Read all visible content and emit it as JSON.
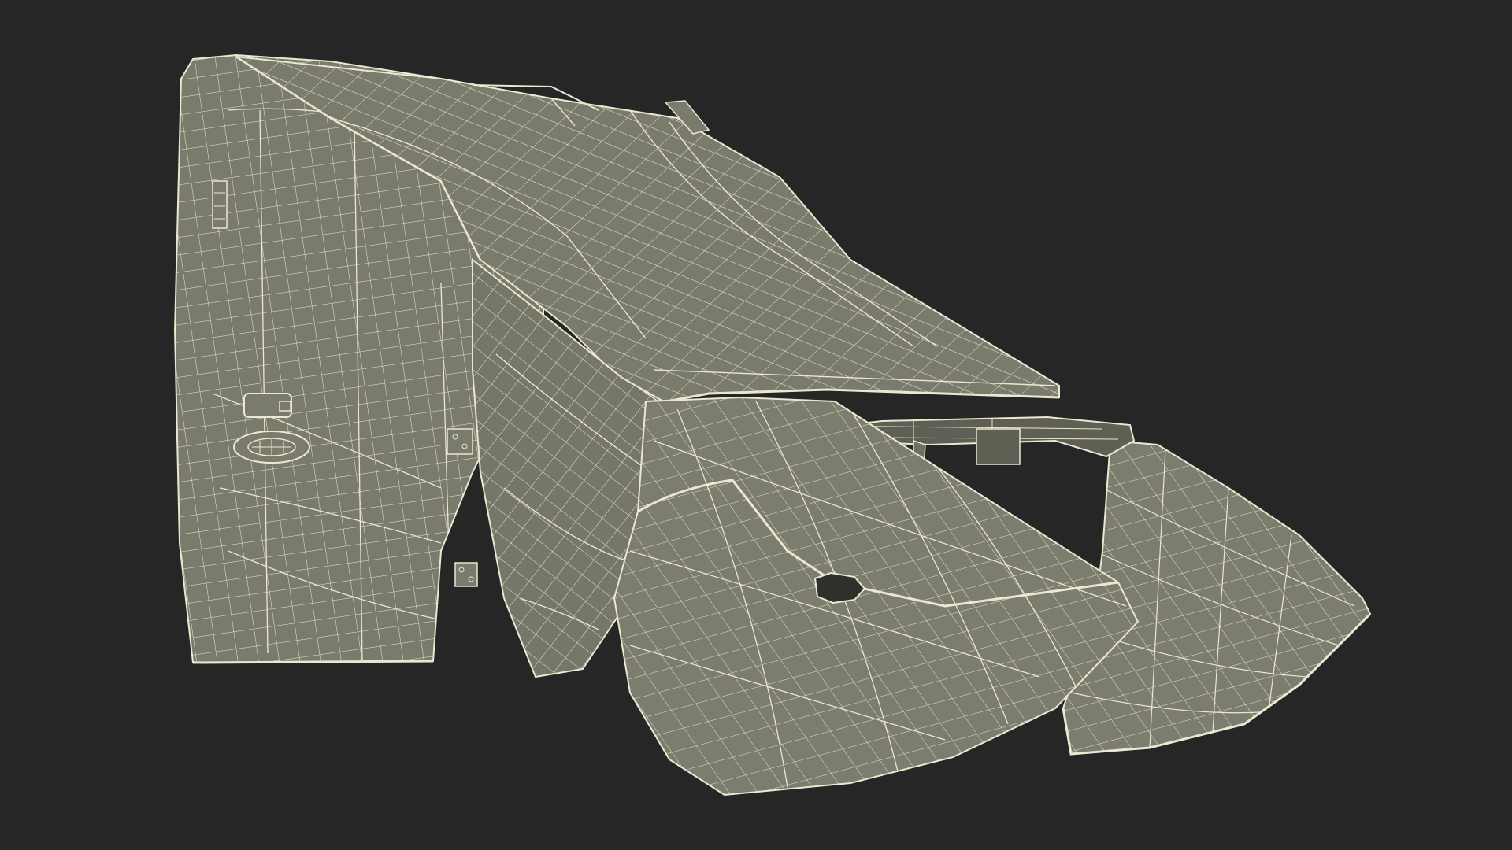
{
  "scene": {
    "subject": "wireframe-render",
    "background_color": "#262626",
    "surface_color": "#7b7b6d",
    "surface_dark_color": "#5f5f53",
    "inner_dark_color": "#2f2f2b",
    "wire_color": "#e9e8d2",
    "grid": true
  }
}
